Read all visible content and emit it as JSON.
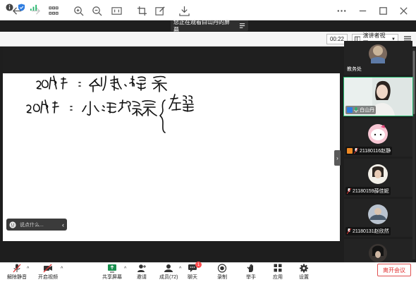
{
  "topbar": {
    "icons": [
      "back-icon",
      "forward-icon",
      "grid-icon",
      "zoom-in-icon",
      "zoom-out-icon",
      "fit-screen-icon",
      "crop-icon",
      "edit-icon",
      "download-icon",
      "more-icon",
      "minimize-icon",
      "maximize-icon",
      "close-icon"
    ]
  },
  "share_banner": {
    "text": "您正在观看白山丹的屏幕",
    "menu_icon": "list-icon"
  },
  "subbar": {
    "timer": "00:22",
    "view_label": "演讲者视图"
  },
  "whiteboard": {
    "line1": "20年代：创新·探索",
    "line2": "30年代：小说繁荣",
    "line3": "左翼"
  },
  "chat": {
    "placeholder": "说点什么..."
  },
  "participants": [
    {
      "name": "教务处"
    },
    {
      "name": "白山丹",
      "active": true
    },
    {
      "name": "21180116赵静"
    },
    {
      "name": "21180159薛佳妮"
    },
    {
      "name": "21180131赵欣然"
    },
    {
      "name": ""
    }
  ],
  "toolbar": {
    "mute": "解除静音",
    "video": "开启视频",
    "share": "共享屏幕",
    "invite": "邀请",
    "members": "成员(72)",
    "chat": "聊天",
    "chat_badge": "1",
    "record": "录制",
    "raise_hand": "举手",
    "apps": "应用",
    "settings": "设置",
    "leave": "离开会议"
  },
  "colors": {
    "accent_green": "#23b66c",
    "leave_red": "#e03030",
    "badge_red": "#ff4d4f"
  }
}
